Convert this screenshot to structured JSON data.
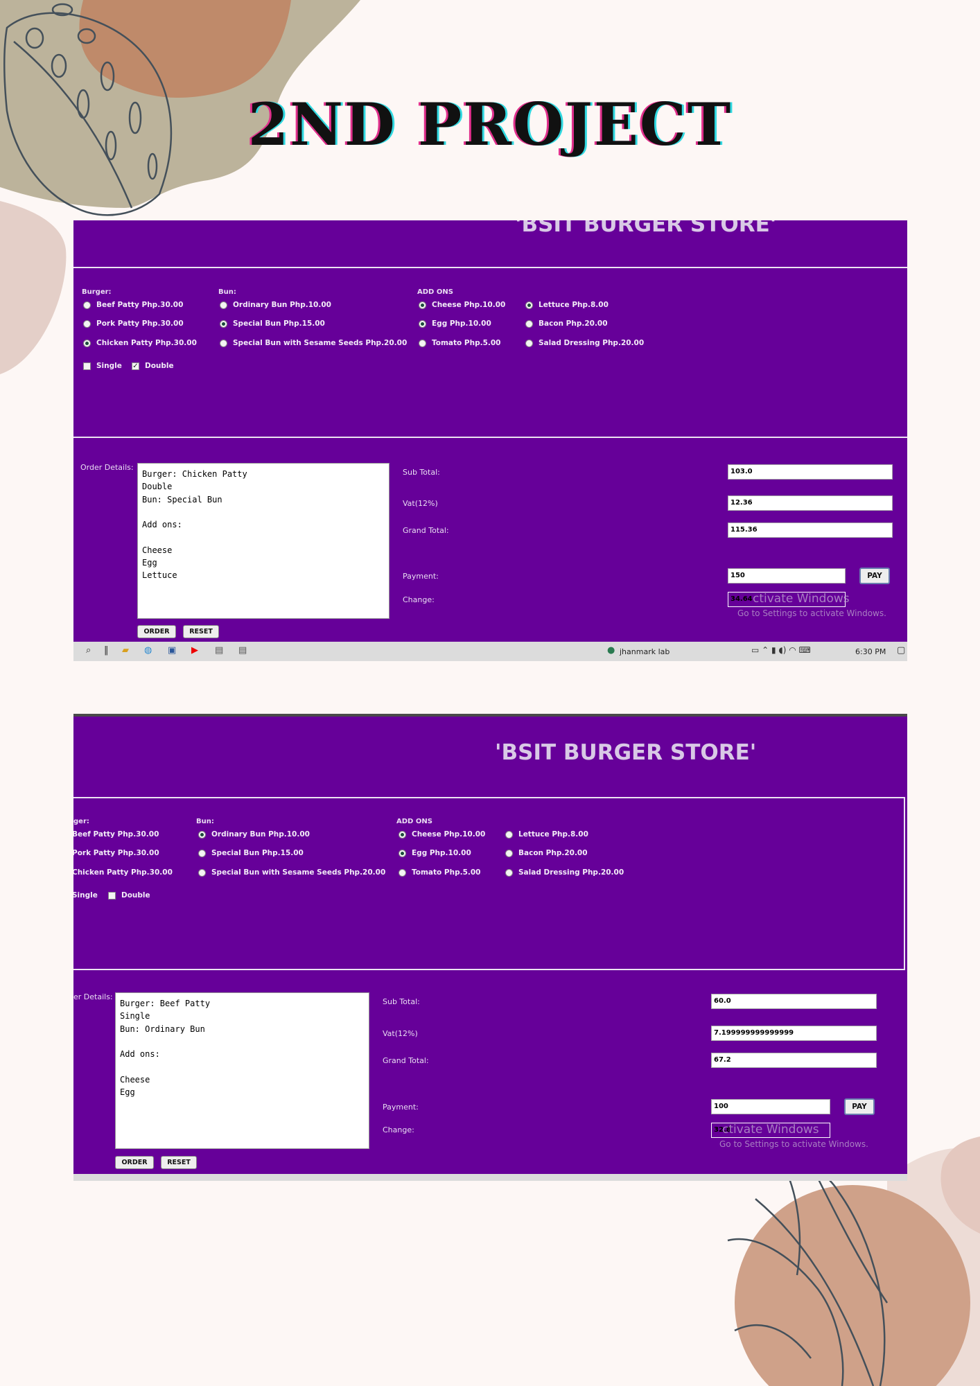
{
  "page": {
    "title": "2ND PROJECT"
  },
  "app": {
    "store_title": "'BSIT BURGER STORE'"
  },
  "sections": {
    "burger": "Burger:",
    "bun": "Bun:",
    "addons": "ADD ONS"
  },
  "labels": {
    "order_details": "Order Details:",
    "order_details_cropped": "er Details:",
    "sub_total": "Sub Total:",
    "vat": "Vat(12%)",
    "grand_total": "Grand Total:",
    "payment": "Payment:",
    "change": "Change:"
  },
  "buttons": {
    "order": "ORDER",
    "reset": "RESET",
    "pay": "PAY"
  },
  "watermark": {
    "line1": "Activate Windows",
    "line1_partial": "ctivate Windows",
    "line2": "Go to Settings to activate Windows."
  },
  "screenshot1": {
    "burger_options": [
      {
        "label": "Beef Patty Php.30.00",
        "selected": false
      },
      {
        "label": "Pork Patty Php.30.00",
        "selected": false
      },
      {
        "label": "Chicken Patty Php.30.00",
        "selected": true
      }
    ],
    "size_options": [
      {
        "label": "Single",
        "checked": false
      },
      {
        "label": "Double",
        "checked": true
      }
    ],
    "bun_options": [
      {
        "label": "Ordinary Bun Php.10.00",
        "selected": false
      },
      {
        "label": "Special Bun Php.15.00",
        "selected": true
      },
      {
        "label": "Special Bun with Sesame Seeds Php.20.00",
        "selected": false
      }
    ],
    "addons_col1": [
      {
        "label": "Cheese Php.10.00",
        "selected": true
      },
      {
        "label": "Egg Php.10.00",
        "selected": true
      },
      {
        "label": "Tomato Php.5.00",
        "selected": false
      }
    ],
    "addons_col2": [
      {
        "label": "Lettuce Php.8.00",
        "selected": true
      },
      {
        "label": "Bacon Php.20.00",
        "selected": false
      },
      {
        "label": "Salad Dressing Php.20.00",
        "selected": false
      }
    ],
    "order_text": "Burger: Chicken Patty\nDouble\nBun: Special Bun\n\nAdd ons:\n\nCheese\nEgg\nLettuce",
    "sub_total": "103.0",
    "vat": "12.36",
    "grand_total": "115.36",
    "payment": "150",
    "change": "34.64",
    "taskbar": {
      "user": "jhanmark lab",
      "time": "6:30 PM"
    }
  },
  "screenshot2": {
    "burger_options": [
      {
        "label": "Beef Patty Php.30.00",
        "selected": false
      },
      {
        "label": "Pork Patty Php.30.00",
        "selected": false
      },
      {
        "label": "Chicken Patty Php.30.00",
        "selected": false
      }
    ],
    "burger_label_cropped": "ger:",
    "size_options": [
      {
        "label": "Single",
        "checked": false
      },
      {
        "label": "Double",
        "checked": false
      }
    ],
    "bun_options": [
      {
        "label": "Ordinary Bun Php.10.00",
        "selected": true
      },
      {
        "label": "Special Bun Php.15.00",
        "selected": false
      },
      {
        "label": "Special Bun with Sesame Seeds Php.20.00",
        "selected": false
      }
    ],
    "addons_col1": [
      {
        "label": "Cheese Php.10.00",
        "selected": true
      },
      {
        "label": "Egg Php.10.00",
        "selected": true
      },
      {
        "label": "Tomato Php.5.00",
        "selected": false
      }
    ],
    "addons_col2": [
      {
        "label": "Lettuce Php.8.00",
        "selected": false
      },
      {
        "label": "Bacon Php.20.00",
        "selected": false
      },
      {
        "label": "Salad Dressing Php.20.00",
        "selected": false
      }
    ],
    "order_text": "Burger: Beef Patty\nSingle\nBun: Ordinary Bun\n\nAdd ons:\n\nCheese\nEgg",
    "sub_total": "60.0",
    "vat": "7.199999999999999",
    "grand_total": "67.2",
    "payment": "100",
    "change": "32.8"
  },
  "colors": {
    "app_bg": "#660099",
    "page_bg": "#fdf7f5",
    "taskbar": "#dcdcdc"
  }
}
